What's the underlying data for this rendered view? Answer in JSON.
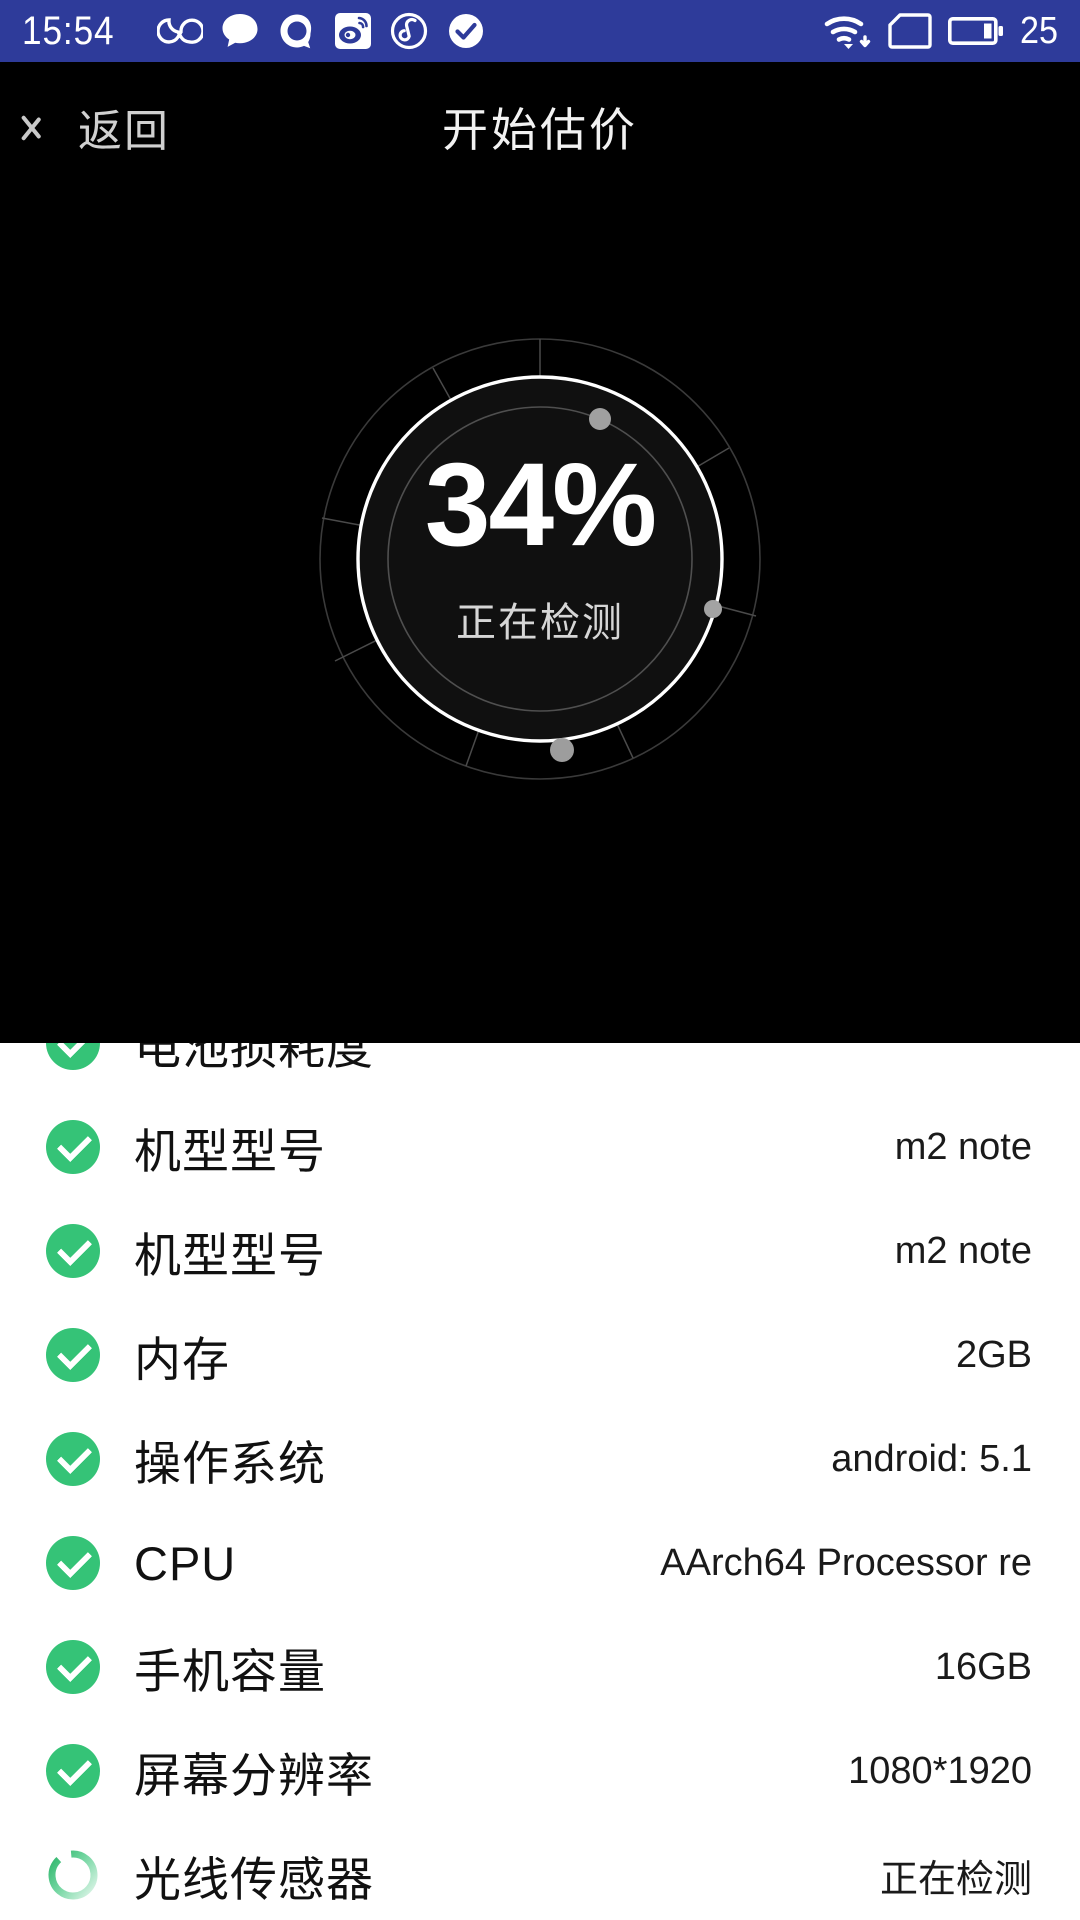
{
  "statusbar": {
    "time": "15:54",
    "battery_level": "25",
    "background": "#2E3B9A",
    "left_icons": [
      {
        "name": "uc-browser-icon",
        "label": "UC"
      },
      {
        "name": "chat-bubble-icon",
        "label": "Messages"
      },
      {
        "name": "qq-icon",
        "label": "QQ"
      },
      {
        "name": "weibo-icon",
        "label": "Weibo"
      },
      {
        "name": "netease-music-icon",
        "label": "NetEase Music"
      },
      {
        "name": "check-circle-icon",
        "label": "Done"
      }
    ],
    "right_icons": [
      {
        "name": "wifi-download-icon",
        "label": "Wi-Fi"
      },
      {
        "name": "sim-card-icon",
        "label": "SIM"
      },
      {
        "name": "battery-icon",
        "label": "Battery"
      }
    ]
  },
  "navbar": {
    "back_label": "返回",
    "title": "开始估价"
  },
  "progress": {
    "percent_text": "34%",
    "percent_value": 34,
    "status_text": "正在检测",
    "ring_color": "#ffffff",
    "dot_color": "#9a9a9a"
  },
  "list": {
    "clipped_row": {
      "label": "电池损耗度",
      "value": "",
      "icon": "check-circle-icon"
    },
    "rows": [
      {
        "label": "机型型号",
        "value": "m2 note",
        "icon": "check-circle-icon"
      },
      {
        "label": "机型型号",
        "value": "m2 note",
        "icon": "check-circle-icon"
      },
      {
        "label": "内存",
        "value": "2GB",
        "icon": "check-circle-icon"
      },
      {
        "label": "操作系统",
        "value": "android: 5.1",
        "icon": "check-circle-icon"
      },
      {
        "label": "CPU",
        "value": "AArch64 Processor re",
        "icon": "check-circle-icon"
      },
      {
        "label": "手机容量",
        "value": "16GB",
        "icon": "check-circle-icon"
      },
      {
        "label": "屏幕分辨率",
        "value": "1080*1920",
        "icon": "check-circle-icon"
      },
      {
        "label": "光线传感器",
        "value": "正在检测",
        "icon": "loading-spinner-icon"
      }
    ],
    "check_color": "#35c377",
    "spinner_color": "#35c377"
  }
}
